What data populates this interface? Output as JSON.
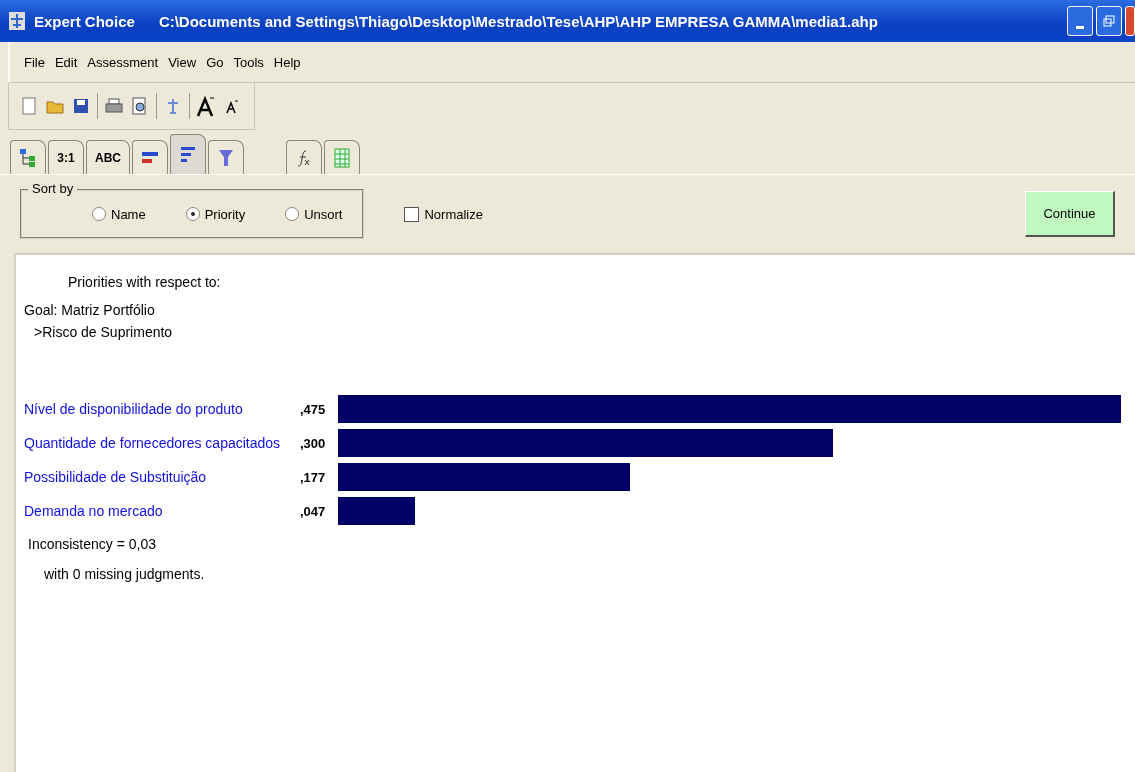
{
  "window": {
    "app": "Expert Choice",
    "path": "C:\\Documents and Settings\\Thiago\\Desktop\\Mestrado\\Tese\\AHP\\AHP EMPRESA GAMMA\\media1.ahp"
  },
  "menu": [
    "File",
    "Edit",
    "Assessment",
    "View",
    "Go",
    "Tools",
    "Help"
  ],
  "tabs": [
    {
      "kind": "tree",
      "selected": false
    },
    {
      "kind": "text",
      "label": "3:1",
      "selected": false
    },
    {
      "kind": "text",
      "label": "ABC",
      "selected": false
    },
    {
      "kind": "graph",
      "selected": false
    },
    {
      "kind": "bars",
      "selected": true
    },
    {
      "kind": "funnel",
      "selected": false
    },
    {
      "kind": "gap"
    },
    {
      "kind": "formula",
      "selected": false
    },
    {
      "kind": "grid",
      "selected": false
    }
  ],
  "sort": {
    "title": "Sort by",
    "options": [
      {
        "label": "Name",
        "selected": false
      },
      {
        "label": "Priority",
        "selected": true
      },
      {
        "label": "Unsort",
        "selected": false
      }
    ]
  },
  "normalize": {
    "label": "Normalize",
    "checked": false
  },
  "continue_button": "Continue",
  "report": {
    "heading": "Priorities with respect to:",
    "goal": "Goal: Matriz Portfólio",
    "node": ">Risco de Suprimento",
    "rows": [
      {
        "name": "Nível de disponibilidade do produto",
        "value": ",475"
      },
      {
        "name": "Quantidade de fornecedores capacitados",
        "value": ",300"
      },
      {
        "name": "Possibilidade de Substituição",
        "value": ",177"
      },
      {
        "name": "Demanda no mercado",
        "value": ",047"
      }
    ],
    "inconsistency": "Inconsistency = 0,03",
    "missing": "with 0  missing judgments."
  }
}
